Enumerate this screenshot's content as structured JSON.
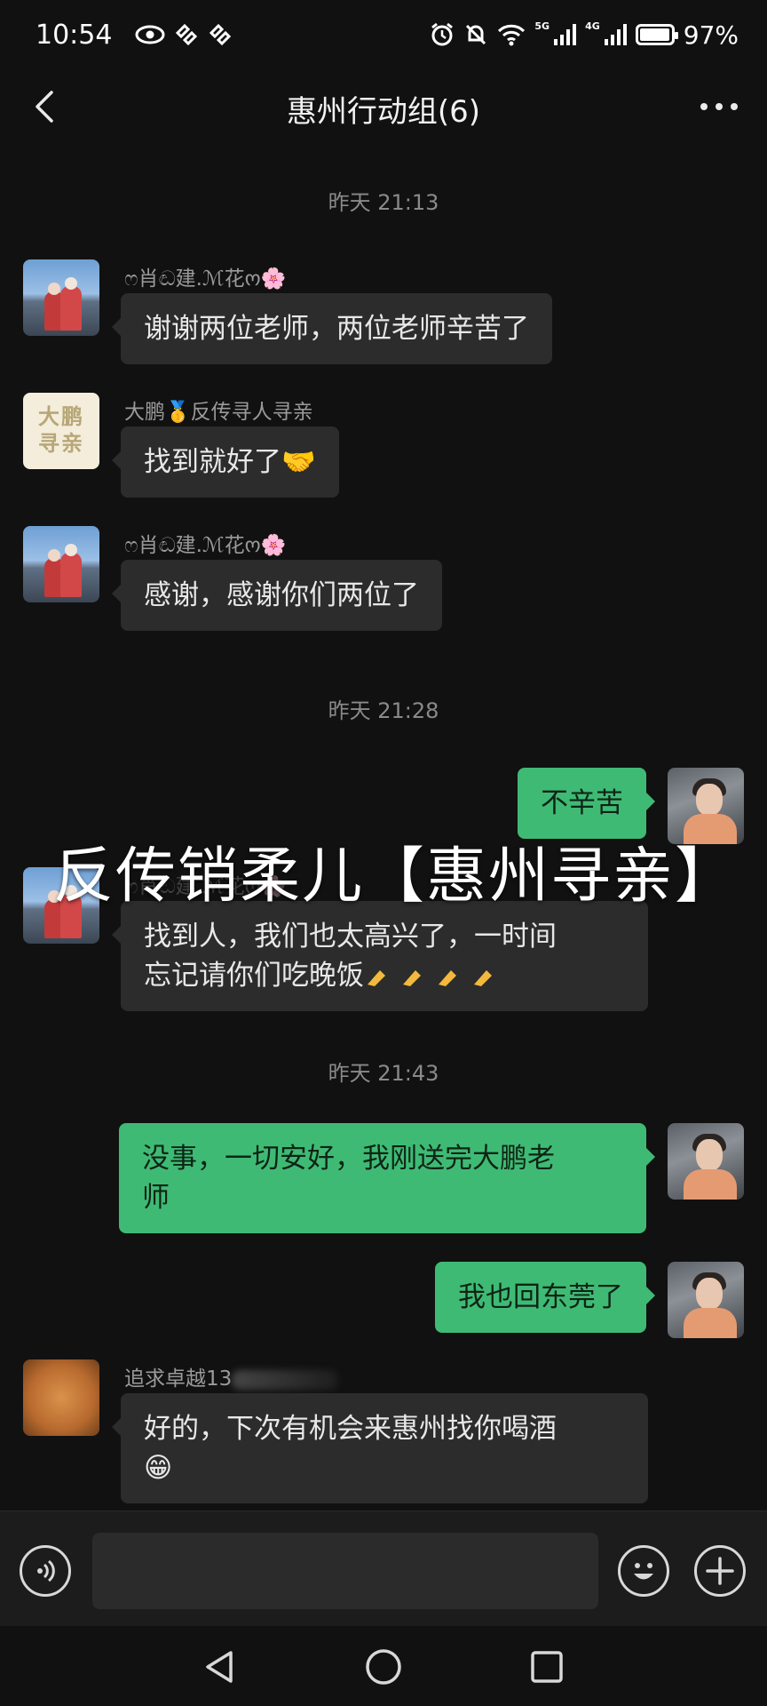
{
  "status_bar": {
    "time": "10:54",
    "net_5g": "5G",
    "net_4g": "4G",
    "battery": "97%",
    "battery_level": 0.97
  },
  "header": {
    "title": "惠州行动组(6)"
  },
  "timestamps": [
    "昨天 21:13",
    "昨天 21:28",
    "昨天 21:43"
  ],
  "messages": [
    {
      "sender": "ෆ肖ඬ建.ℳ花ო🌸",
      "text": "谢谢两位老师，两位老师辛苦了"
    },
    {
      "sender": "大鹏🥇反传寻人寻亲",
      "text": "找到就好了🤝"
    },
    {
      "sender": "ෆ肖ඬ建.ℳ花ო🌸",
      "text": "感谢，感谢你们两位了"
    },
    {
      "text": "不辛苦"
    },
    {
      "sender": "ෆ肖ඬ建.ℳ花ო🌸",
      "text_line1": "找到人，我们也太高兴了，一时间",
      "text_line2": "忘记请你们吃晚饭"
    },
    {
      "text_line1": "没事，一切安好，我刚送完大鹏老",
      "text_line2": "师"
    },
    {
      "text": "我也回东莞了"
    },
    {
      "sender": "追求卓越13",
      "text_line1": "好的，下次有机会来惠州找你喝酒",
      "text_line2": "😁"
    }
  ],
  "avatars": {
    "dapeng_text_1": "大鹏",
    "dapeng_text_2": "寻亲"
  },
  "watermark": "反传销柔儿【惠州寻亲】",
  "input": {
    "placeholder": ""
  },
  "colors": {
    "background": "#111111",
    "incoming_bubble": "#2c2c2c",
    "outgoing_bubble": "#3fba74"
  },
  "icons": [
    "back-icon",
    "more-icon",
    "voice-icon",
    "emoji-icon",
    "plus-icon",
    "nav-back-icon",
    "nav-home-icon",
    "nav-recents-icon"
  ]
}
